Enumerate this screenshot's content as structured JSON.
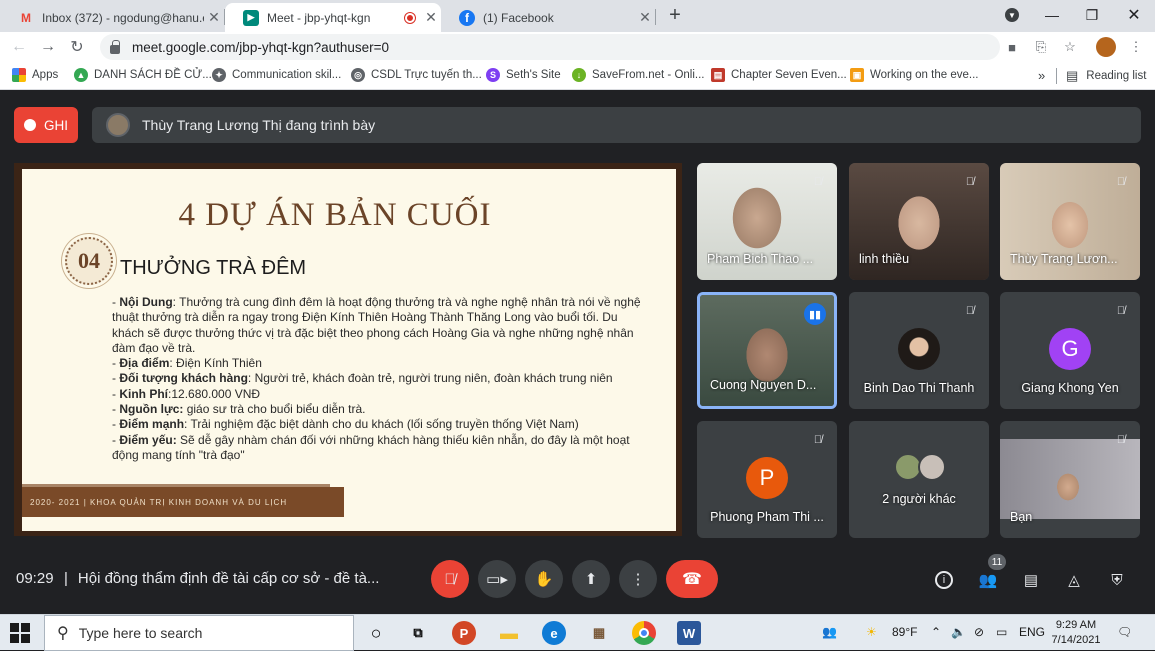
{
  "browser": {
    "tabs": [
      {
        "title": "Inbox (372) - ngodung@hanu.ed",
        "icon": "gmail-icon"
      },
      {
        "title": "Meet - jbp-yhqt-kgn",
        "icon": "meet-icon",
        "recording": true
      },
      {
        "title": "(1) Facebook",
        "icon": "facebook-icon"
      }
    ],
    "new_tab": "+",
    "url": "meet.google.com/jbp-yhqt-kgn?authuser=0",
    "bookmarks": [
      {
        "label": "Apps",
        "color": "#4285f4"
      },
      {
        "label": "DANH SÁCH ĐỀ CỬ...",
        "color": "#34a853"
      },
      {
        "label": "Communication skil...",
        "color": "#5f6368"
      },
      {
        "label": "CSDL Trực tuyến th...",
        "color": "#5f6368"
      },
      {
        "label": "Seth's Site",
        "color": "#7e3ff2"
      },
      {
        "label": "SaveFrom.net - Onli...",
        "color": "#6bb324"
      },
      {
        "label": "Chapter Seven Even...",
        "color": "#c0392b"
      },
      {
        "label": "Working on the eve...",
        "color": "#f39c12"
      }
    ],
    "more_bookmarks": "»",
    "reading_list": "Reading list"
  },
  "meet": {
    "record_label": "GHI",
    "presenting_text": "Thùy Trang Lương Thị đang trình bày",
    "slide": {
      "title": "4 DỰ ÁN BẢN CUỐI",
      "number": "04",
      "subtitle": "THƯỞNG TRÀ ĐÊM",
      "lines": [
        {
          "label": "Nội Dung",
          "text": ": Thưởng trà cung đình đêm là hoạt động thưởng trà và nghe nghệ nhân trà nói về nghệ thuật thưởng trà diễn ra ngay trong Điện Kính Thiên Hoàng Thành Thăng Long vào buổi tối. Du khách sẽ được thưởng thức vị trà đặc biệt theo phong cách Hoàng Gia và nghe những nghệ nhân đàm đạo về trà."
        },
        {
          "label": "Địa điểm",
          "text": ": Điện Kính Thiên"
        },
        {
          "label": "Đối tượng khách hàng",
          "text": ": Người trẻ, khách đoàn trẻ, người trung niên, đoàn khách trung niên"
        },
        {
          "label": "Kinh Phí",
          "text": ":12.680.000 VNĐ"
        },
        {
          "label": "Nguồn lực:",
          "text": "  giáo sư trà cho buổi biểu diễn trà."
        },
        {
          "label": "Điểm mạnh",
          "text": ": Trải nghiệm đặc biệt dành cho du khách (lối sống truyền thống Việt Nam)"
        },
        {
          "label": "Điểm yếu:",
          "text": " Sẽ dễ gây nhàm chán đối với những khách hàng thiếu kiên nhẫn, do đây là một hoạt động mang tính \"trà đạo\""
        }
      ],
      "footer": "2020- 2021 | KHOA QUẢN TRỊ KINH DOANH VÀ DU LỊCH"
    },
    "participants": [
      {
        "name": "Pham Bich Thao ...",
        "muted": true,
        "type": "video"
      },
      {
        "name": "linh thiều",
        "muted": true,
        "type": "video"
      },
      {
        "name": "Thùy Trang Lươn...",
        "muted": true,
        "type": "video"
      },
      {
        "name": "Cuong Nguyen D...",
        "muted": false,
        "speaking": true,
        "type": "video"
      },
      {
        "name": "Binh Dao Thi Thanh",
        "muted": true,
        "type": "photo"
      },
      {
        "name": "Giang Khong Yen",
        "muted": true,
        "type": "letter",
        "letter": "G",
        "color": "#a142f4"
      },
      {
        "name": "Phuong Pham Thi ...",
        "muted": true,
        "type": "letter",
        "letter": "P",
        "color": "#e8590c"
      },
      {
        "name": "2 người khác",
        "muted": false,
        "type": "group"
      },
      {
        "name": "Bạn",
        "muted": true,
        "type": "video"
      }
    ],
    "time": "09:29",
    "divider": "|",
    "meeting_title": "Hội đồng thẩm định đề tài cấp cơ sở - đề tà...",
    "participant_count": "11"
  },
  "taskbar": {
    "search_placeholder": "Type here to search",
    "weather": "89°F",
    "language": "ENG",
    "time": "9:29 AM",
    "date": "7/14/2021"
  }
}
